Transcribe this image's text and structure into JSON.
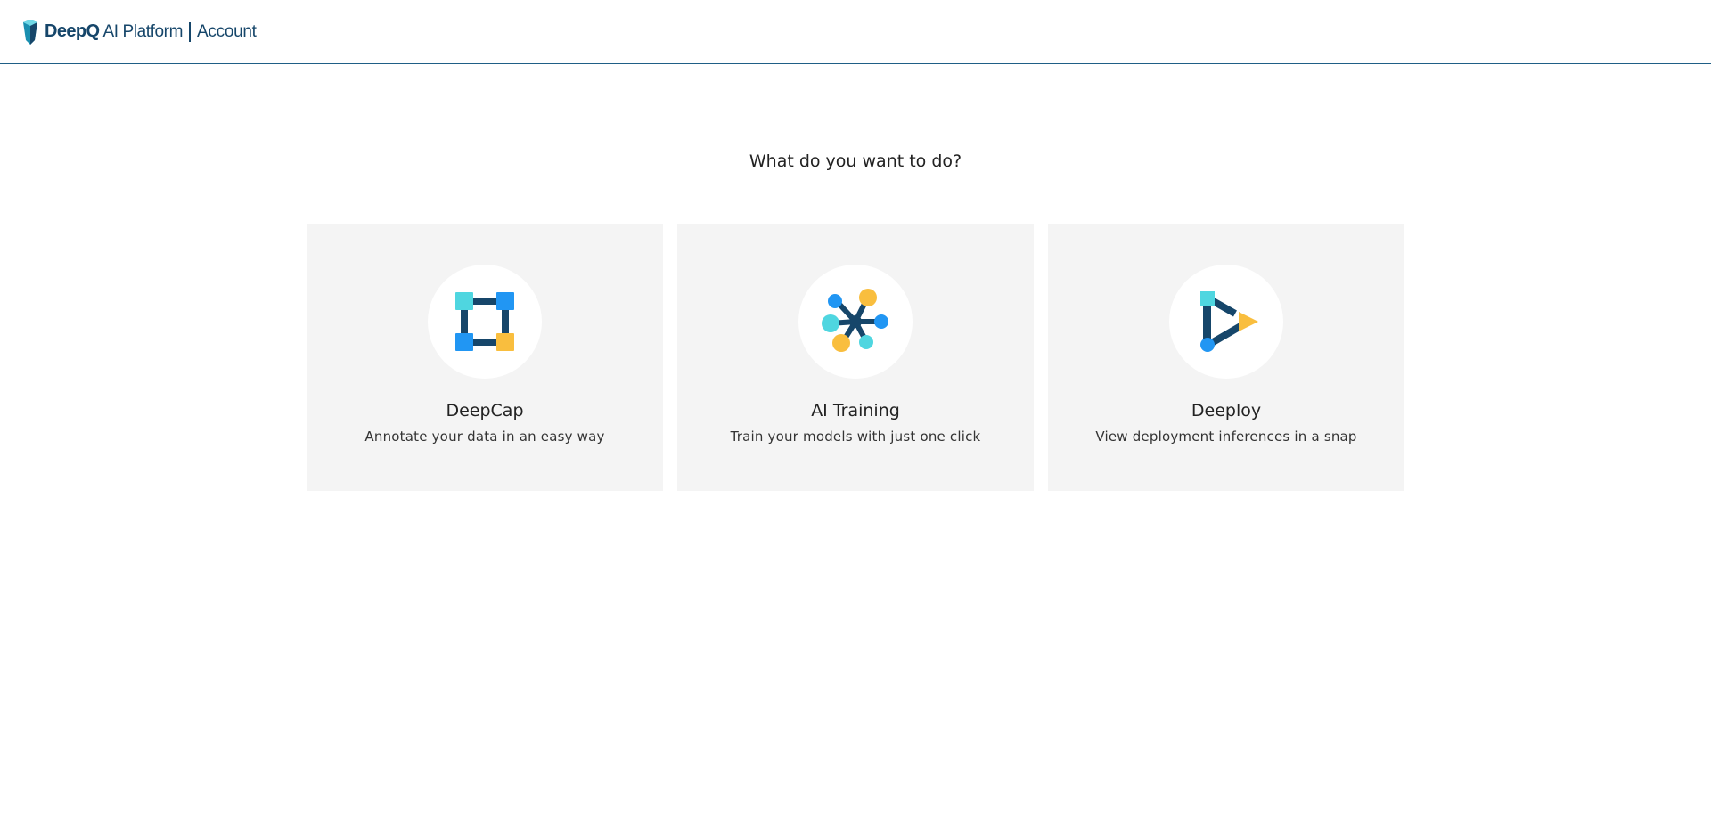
{
  "header": {
    "brand_name": "DeepQ",
    "brand_platform": "AI Platform",
    "brand_section": "Account"
  },
  "main": {
    "title": "What do you want to do?",
    "cards": [
      {
        "title": "DeepCap",
        "description": "Annotate your data in an easy way",
        "icon": "deepcap-icon"
      },
      {
        "title": "AI Training",
        "description": "Train your models with just one click",
        "icon": "ai-training-icon"
      },
      {
        "title": "Deeploy",
        "description": "View deployment inferences in a snap",
        "icon": "deeploy-icon"
      }
    ]
  },
  "colors": {
    "navy": "#16466a",
    "cyan": "#4fd6e0",
    "blue": "#2196f3",
    "yellow": "#f9be3e",
    "card_bg": "#f4f4f4"
  }
}
